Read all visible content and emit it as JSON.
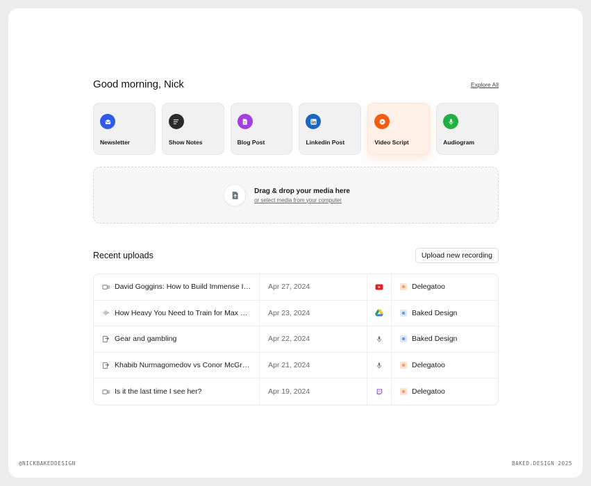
{
  "header": {
    "greeting": "Good morning, Nick",
    "explore_label": "Explore All"
  },
  "cards": [
    {
      "label": "Newsletter",
      "icon": "envelope-icon",
      "color": "#2f5bea"
    },
    {
      "label": "Show Notes",
      "icon": "notes-icon",
      "color": "#2b2b2b"
    },
    {
      "label": "Blog Post",
      "icon": "document-icon",
      "color": "#a43ee0"
    },
    {
      "label": "Linkedin Post",
      "icon": "linkedin-icon",
      "color": "#1a66c2"
    },
    {
      "label": "Video Script",
      "icon": "play-icon",
      "color": "#f25d14",
      "active": true
    },
    {
      "label": "Audiogram",
      "icon": "microphone-icon",
      "color": "#23b043"
    }
  ],
  "dropzone": {
    "title": "Drag & drop your media here",
    "subtitle": "or select media from your computer"
  },
  "recent": {
    "title": "Recent uploads",
    "upload_label": "Upload new recording",
    "rows": [
      {
        "type_icon": "video-icon",
        "title": "David Goggins: How to Build Immense Inner Strength",
        "date": "Apr 27, 2024",
        "source_icon": "youtube-icon",
        "workspace": "Delegatoo",
        "ws_color": "orange"
      },
      {
        "type_icon": "waveform-icon",
        "title": "How Heavy You Need to Train for Max Muscle Growth",
        "date": "Apr 23, 2024",
        "source_icon": "google-drive-icon",
        "workspace": "Baked Design",
        "ws_color": "blue"
      },
      {
        "type_icon": "podcast-icon",
        "title": "Gear and gambling",
        "date": "Apr 22, 2024",
        "source_icon": "microphone-icon",
        "workspace": "Baked Design",
        "ws_color": "blue"
      },
      {
        "type_icon": "podcast-icon",
        "title": "Khabib Nurmagomedov vs Conor McGregor",
        "date": "Apr 21, 2024",
        "source_icon": "microphone-icon",
        "workspace": "Delegatoo",
        "ws_color": "orange"
      },
      {
        "type_icon": "video-icon",
        "title": "Is it the last time I see her?",
        "date": "Apr 19, 2024",
        "source_icon": "twitch-icon",
        "workspace": "Delegatoo",
        "ws_color": "orange"
      }
    ]
  },
  "footer": {
    "left": "@NICKBAKEDDESIGN",
    "right": "BAKED.DESIGN 2025"
  }
}
